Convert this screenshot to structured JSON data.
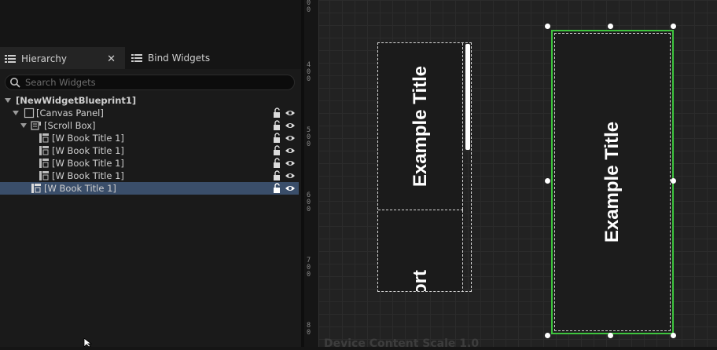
{
  "tabs": [
    {
      "label": "Hierarchy",
      "icon": "list-icon",
      "active": true
    },
    {
      "label": "Bind Widgets",
      "icon": "list-icon",
      "active": false
    }
  ],
  "search": {
    "placeholder": "Search Widgets"
  },
  "tree": [
    {
      "label": "[NewWidgetBlueprint1]",
      "bold": true
    },
    {
      "label": "[Canvas Panel]"
    },
    {
      "label": "[Scroll Box]"
    },
    {
      "label": "[W Book Title 1]"
    },
    {
      "label": "[W Book Title 1]"
    },
    {
      "label": "[W Book Title 1]"
    },
    {
      "label": "[W Book Title 1]"
    },
    {
      "label": "[W Book Title 1]",
      "selected": true
    }
  ],
  "ruler": {
    "labels": [
      {
        "digits": [
          "0",
          "0"
        ]
      },
      {
        "digits": [
          "4",
          "0",
          "0"
        ]
      },
      {
        "digits": [
          "5",
          "0",
          "0"
        ]
      },
      {
        "digits": [
          "6",
          "0",
          "0"
        ]
      },
      {
        "digits": [
          "7",
          "0",
          "0"
        ]
      },
      {
        "digits": [
          "8",
          "0"
        ]
      }
    ]
  },
  "canvas": {
    "scroll_card_title": "Example Title",
    "scroll_card_partial": "ort",
    "selected_card_title": "Example Title",
    "dpi_text": "Device Content Scale 1.0"
  },
  "colors": {
    "selection": "#3ec43e",
    "tree_selected": "#3a4e6a"
  }
}
